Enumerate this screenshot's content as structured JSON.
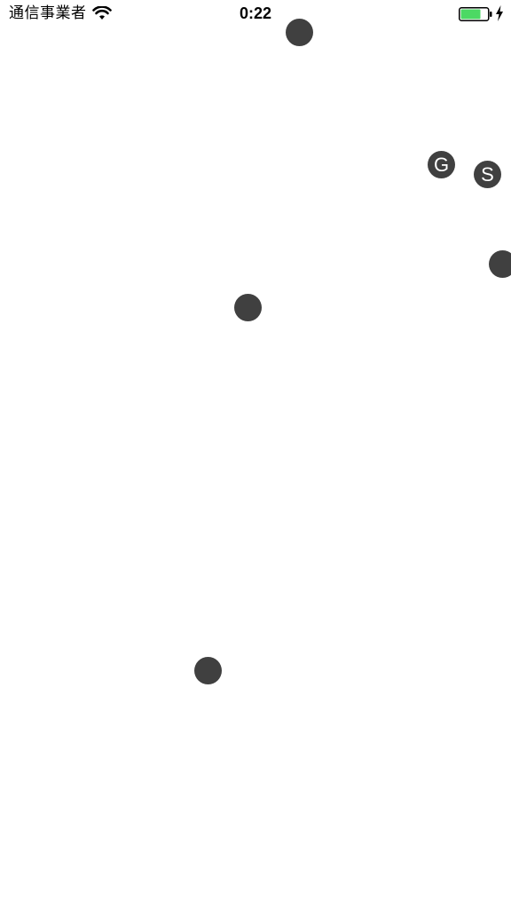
{
  "status_bar": {
    "carrier": "通信事業者",
    "time": "0:22",
    "battery_color": "#4cd964",
    "icons": [
      "wifi-icon",
      "battery-icon",
      "charging-bolt-icon"
    ]
  },
  "canvas": {
    "dot_color": "#404040",
    "dots": [
      {
        "label": ""
      },
      {
        "label": "G"
      },
      {
        "label": "S"
      },
      {
        "label": ""
      },
      {
        "label": ""
      },
      {
        "label": ""
      }
    ]
  }
}
